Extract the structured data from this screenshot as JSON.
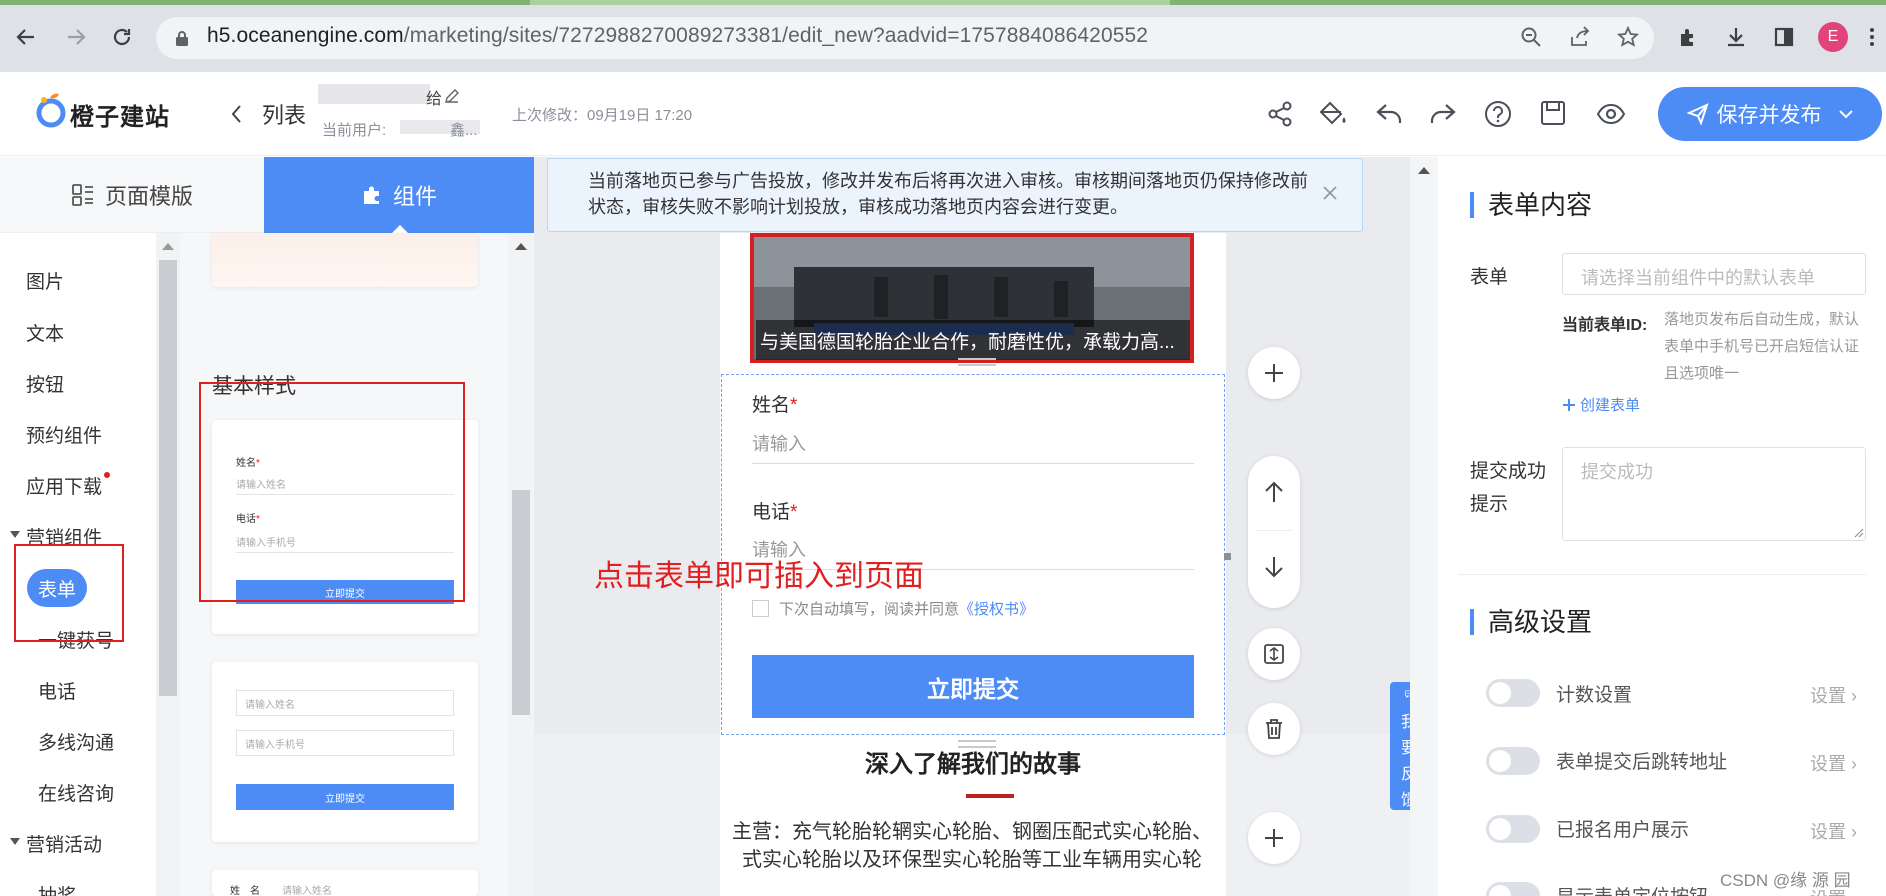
{
  "browser": {
    "url_host": "h5.oceanengine.com",
    "url_path": "/marketing/sites/7272988270089273381/edit_new?aadvid=1757884086420552",
    "avatar_letter": "E"
  },
  "header": {
    "logo_text": "橙子建站",
    "back_label": "列表",
    "page_name_tail": "给",
    "current_user_label": "当前用户:",
    "current_user_tail": "鑫...",
    "last_modified": "上次修改：09月19日 17:20",
    "publish_label": "保存并发布"
  },
  "left_tabs": {
    "templates": "页面模版",
    "components": "组件"
  },
  "categories": [
    {
      "label": "图片",
      "indent": false
    },
    {
      "label": "文本",
      "indent": false
    },
    {
      "label": "按钮",
      "indent": false
    },
    {
      "label": "预约组件",
      "indent": false
    },
    {
      "label": "应用下载",
      "indent": false
    },
    {
      "label": "营销组件",
      "indent": false
    },
    {
      "label": "表单",
      "indent": true
    },
    {
      "label": "一键获号",
      "indent": true
    },
    {
      "label": "电话",
      "indent": true
    },
    {
      "label": "多线沟通",
      "indent": true
    },
    {
      "label": "在线咨询",
      "indent": true
    },
    {
      "label": "营销活动",
      "indent": false
    },
    {
      "label": "抽奖",
      "indent": true
    }
  ],
  "preview": {
    "section_title": "基本样式",
    "card1": {
      "name_label": "姓名",
      "name_ph": "请输入姓名",
      "phone_label": "电话",
      "phone_ph": "请输入手机号",
      "button": "立即提交"
    },
    "card2": {
      "name_ph": "请输入姓名",
      "phone_ph": "请输入手机号",
      "button": "立即提交"
    },
    "card3": {
      "name_label": "姓　名",
      "name_ph": "请输入姓名"
    }
  },
  "notice": "当前落地页已参与广告投放，修改并发布后将再次进入审核。审核期间落地页仍保持修改前状态，审核失败不影响计划投放，审核成功落地页内容会进行变更。",
  "canvas": {
    "photo_caption": "与美国德国轮胎企业合作，耐磨性优，承载力高...",
    "form": {
      "name_label": "姓名",
      "name_ph": "请输入",
      "phone_label": "电话",
      "phone_ph": "请输入",
      "required_mark": "*",
      "consent_text": "下次自动填写，阅读并同意",
      "consent_link": "《授权书》",
      "submit": "立即提交"
    },
    "annotation": "点击表单即可插入到页面",
    "story_title": "深入了解我们的故事",
    "story_text_1": "主营：充气轮胎轮辋实心轮胎、钢圈压配式实心轮胎、",
    "story_text_2": "式实心轮胎以及环保型实心轮胎等工业车辆用实心轮",
    "feedback": [
      "我",
      "要",
      "反",
      "馈"
    ]
  },
  "right_panel": {
    "form_content_title": "表单内容",
    "form_label": "表单",
    "form_placeholder": "请选择当前组件中的默认表单",
    "current_form_id_label": "当前表单ID:",
    "current_form_id_note": "落地页发布后自动生成，默认表单中手机号已开启短信认证且选项唯一",
    "create_form": "创建表单",
    "success_tip_label_1": "提交成功",
    "success_tip_label_2": "提示",
    "success_placeholder": "提交成功",
    "advanced_title": "高级设置",
    "settings": [
      {
        "label": "计数设置",
        "link": "设置"
      },
      {
        "label": "表单提交后跳转地址",
        "link": "设置"
      },
      {
        "label": "已报名用户展示",
        "link": "设置"
      },
      {
        "label": "显示表单定位按钮",
        "link": "设置"
      }
    ]
  },
  "watermark": "CSDN @缘 源 园",
  "colors": {
    "primary": "#4d8bf5",
    "annotation_red": "#e02020",
    "tab_green": "#7fb374"
  }
}
